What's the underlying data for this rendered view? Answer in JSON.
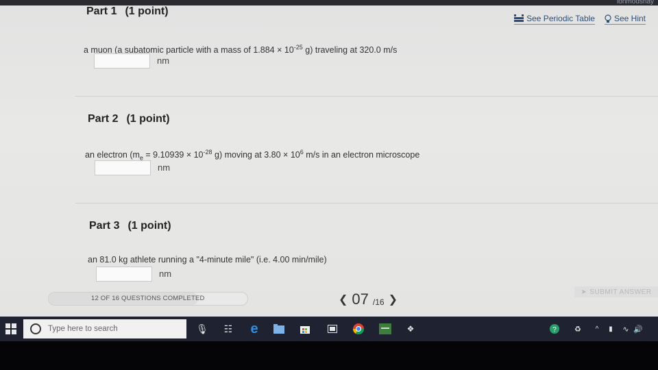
{
  "tools": {
    "periodic_table": "See Periodic Table",
    "hint": "See Hint"
  },
  "top_right_text": "ionmodsnay",
  "parts": [
    {
      "heading": "Part 1",
      "points": "(1 point)",
      "question_a": "a muon (a subatomic particle with a mass of 1.884 × 10",
      "exp_a": "-25",
      "question_b": " g) traveling at 320.0 m/s",
      "unit": "nm"
    },
    {
      "heading": "Part 2",
      "points": "(1 point)",
      "question_a": "an electron (m",
      "sub_a": "e",
      "question_b": " = 9.10939 × 10",
      "exp_b": "-28",
      "question_c": " g) moving at 3.80 × 10",
      "exp_c": "6",
      "question_d": " m/s in an electron microscope",
      "unit": "nm"
    },
    {
      "heading": "Part 3",
      "points": "(1 point)",
      "question": "an 81.0 kg athlete running a \"4-minute mile\" (i.e. 4.00 min/mile)",
      "unit": "nm"
    }
  ],
  "progress": {
    "label": "12 OF 16 QUESTIONS COMPLETED",
    "fraction": 0.75
  },
  "pager": {
    "current": "07",
    "total": "/16"
  },
  "submit_label": "SUBMIT ANSWER",
  "taskbar": {
    "search_placeholder": "Type here to search"
  }
}
